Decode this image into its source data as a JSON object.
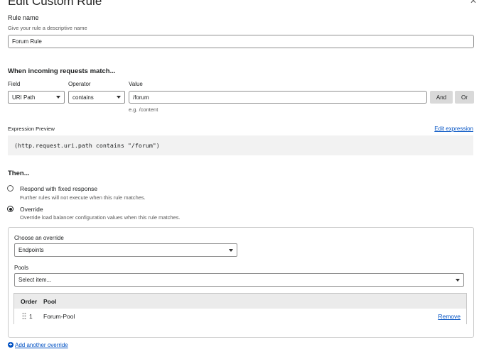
{
  "page": {
    "title": "Edit Custom Rule"
  },
  "rule_name": {
    "label": "Rule name",
    "hint": "Give your rule a descriptive name",
    "value": "Forum Rule"
  },
  "match": {
    "heading": "When incoming requests match...",
    "field_label": "Field",
    "operator_label": "Operator",
    "value_label": "Value",
    "field_value": "URI Path",
    "operator_value": "contains",
    "value_input": "/forum",
    "value_hint": "e.g. /content",
    "and_label": "And",
    "or_label": "Or"
  },
  "expression": {
    "label": "Expression Preview",
    "edit_link": "Edit expression",
    "code": "(http.request.uri.path contains \"/forum\")"
  },
  "then": {
    "heading": "Then...",
    "options": [
      {
        "label": "Respond with fixed response",
        "description": "Further rules will not execute when this rule matches.",
        "selected": false
      },
      {
        "label": "Override",
        "description": "Override load balancer configuration values when this rule matches.",
        "selected": true
      }
    ]
  },
  "override": {
    "choose_label": "Choose an override",
    "choose_value": "Endpoints",
    "pools_label": "Pools",
    "pools_placeholder": "Select item...",
    "table": {
      "columns": [
        "Order",
        "Pool"
      ],
      "rows": [
        {
          "order": "1",
          "pool": "Forum-Pool",
          "action": "Remove"
        }
      ]
    },
    "add_link": "Add another override"
  },
  "icons": {
    "close": "close-icon",
    "dropdown": "chevron-down-icon",
    "drag": "drag-handle-icon",
    "add": "plus-circle-icon"
  },
  "colors": {
    "link": "#0051c3",
    "button_gray": "#d9d9d9",
    "code_bg": "#f2f2f2"
  }
}
